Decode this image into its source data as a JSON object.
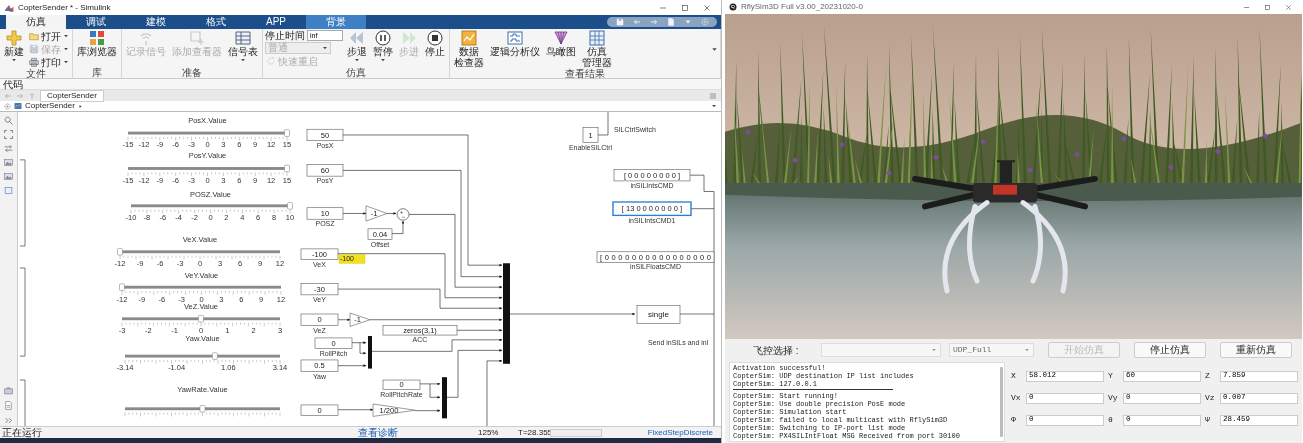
{
  "simulink": {
    "title": "CopterSender * - Simulink",
    "tabs": [
      {
        "label": "仿真",
        "selected": true,
        "contextual": false
      },
      {
        "label": "调试",
        "selected": false,
        "contextual": false
      },
      {
        "label": "建模",
        "selected": false,
        "contextual": false
      },
      {
        "label": "格式",
        "selected": false,
        "contextual": false
      },
      {
        "label": "APP",
        "selected": false,
        "contextual": false
      },
      {
        "label": "背景",
        "selected": false,
        "contextual": true
      }
    ],
    "ribbon_groups": [
      {
        "label": "文件",
        "items": [
          {
            "kind": "large",
            "label": "新建",
            "disabled": false,
            "menu": true
          },
          {
            "kind": "small",
            "label": "打开",
            "disabled": false,
            "menu": true
          },
          {
            "kind": "small",
            "label": "保存",
            "disabled": true,
            "menu": true
          },
          {
            "kind": "small",
            "label": "打印",
            "disabled": false,
            "menu": true
          }
        ]
      },
      {
        "label": "库",
        "items": [
          {
            "kind": "large",
            "label": "库浏览器",
            "disabled": false,
            "menu": false
          }
        ]
      },
      {
        "label": "准备",
        "items": [
          {
            "kind": "large",
            "label": "记录信号",
            "disabled": true,
            "menu": false
          },
          {
            "kind": "large",
            "label": "添加查看器",
            "disabled": true,
            "menu": false
          },
          {
            "kind": "large",
            "label": "信号表",
            "disabled": false,
            "menu": true
          }
        ]
      },
      {
        "label": "仿真",
        "items": [
          {
            "kind": "field",
            "label": "停止时间",
            "value": "inf",
            "disabled": false
          },
          {
            "kind": "dropdown",
            "label": "普通",
            "disabled": true,
            "menu": true
          },
          {
            "kind": "small",
            "label": "快速重启",
            "disabled": true,
            "menu": false
          },
          {
            "kind": "large",
            "label": "步退",
            "disabled": false,
            "menu": true
          },
          {
            "kind": "large",
            "label": "暂停",
            "disabled": false,
            "menu": true
          },
          {
            "kind": "large",
            "label": "步进",
            "disabled": true,
            "menu": false
          },
          {
            "kind": "large",
            "label": "停止",
            "disabled": false,
            "menu": false
          }
        ]
      },
      {
        "label": "查看结果",
        "items": [
          {
            "kind": "large",
            "label_lines": [
              "数据",
              "检查器"
            ],
            "disabled": false,
            "menu": false
          },
          {
            "kind": "large",
            "label": "逻辑分析仪",
            "disabled": false,
            "menu": false
          },
          {
            "kind": "large",
            "label": "鸟瞰图",
            "disabled": false,
            "menu": false
          },
          {
            "kind": "large",
            "label_lines": [
              "仿真",
              "管理器"
            ],
            "disabled": false,
            "menu": false
          }
        ]
      }
    ],
    "code_bar": "代码",
    "model_tab": "CopterSender",
    "breadcrumb": "CopterSender",
    "diagram": {
      "sliders": [
        {
          "label": "PosX.Value",
          "level": 1,
          "ticks": [
            "-15",
            "-12",
            "-9",
            "-6",
            "-3",
            "0",
            "3",
            "6",
            "9",
            "12",
            "15"
          ]
        },
        {
          "label": "PosY.Value",
          "level": 1,
          "ticks": [
            "-15",
            "-12",
            "-9",
            "-6",
            "-3",
            "0",
            "3",
            "6",
            "9",
            "12",
            "15"
          ]
        },
        {
          "label": "POSZ.Value",
          "level": 1,
          "ticks": [
            "-10",
            "-8",
            "-6",
            "-4",
            "-2",
            "0",
            "2",
            "4",
            "6",
            "8",
            "10"
          ]
        },
        {
          "label": "VeX.Value",
          "level": 0,
          "ticks": [
            "-12",
            "-9",
            "-6",
            "-3",
            "0",
            "3",
            "6",
            "9",
            "12"
          ]
        },
        {
          "label": "VeY.Value",
          "level": 0,
          "ticks": [
            "-12",
            "-9",
            "-6",
            "-3",
            "0",
            "3",
            "6",
            "9",
            "12"
          ]
        },
        {
          "label": "VeZ.Value",
          "level": 0.5,
          "ticks": [
            "-3",
            "-2",
            "-1",
            "0",
            "1",
            "2",
            "3"
          ]
        },
        {
          "label": "Yaw.Value",
          "level": 0.58,
          "ticks": [
            "-3.14",
            "-1.04",
            "1.06",
            "3.14"
          ]
        },
        {
          "label": "YawRate.Value",
          "level": 0.5
        }
      ],
      "blocks": [
        {
          "kind": "constant",
          "value": "50",
          "label": "PosX",
          "selected": false
        },
        {
          "kind": "constant",
          "value": "1",
          "label": "EnableSILCtrl",
          "selected": false
        },
        {
          "kind": "constant",
          "value": "60",
          "label": "PosY",
          "selected": false
        },
        {
          "kind": "constant",
          "value": "[ 0 0 0 0 0 0 0 0 ]",
          "label": "inSILIntsCMD",
          "selected": false
        },
        {
          "kind": "constant",
          "value": "10",
          "label": "POSZ",
          "selected": false
        },
        {
          "kind": "gain",
          "value": "-1",
          "selected": false
        },
        {
          "kind": "constant",
          "value": "[ 13 0 0 0 0 0 0 0 ]",
          "label": "inSILIntsCMD1",
          "selected": true
        },
        {
          "kind": "constant",
          "value": "0.04",
          "label": "Offset",
          "selected": false
        },
        {
          "kind": "constant",
          "value": "-100",
          "label": "VeX",
          "selected": false
        },
        {
          "kind": "display",
          "value": "-100",
          "selected": false
        },
        {
          "kind": "constant",
          "value": "[ 0 0 0 0 0 0 0 0 0 0 0 0 0 0 0 0",
          "label": "inSILFloatsCMD",
          "selected": false
        },
        {
          "kind": "constant",
          "value": "-30",
          "label": "VeY",
          "selected": false
        },
        {
          "kind": "constant",
          "value": "0",
          "label": "VeZ",
          "selected": false
        },
        {
          "kind": "gain",
          "value": "-1",
          "selected": false
        },
        {
          "kind": "convert",
          "value": "single",
          "selected": false
        },
        {
          "kind": "constant",
          "value": "zeros(3,1)",
          "label": "ACC",
          "selected": false
        },
        {
          "kind": "constant",
          "value": "0",
          "label": "RollPitch",
          "selected": false
        },
        {
          "kind": "constant",
          "value": "0.5",
          "label": "Yaw",
          "selected": false
        },
        {
          "kind": "constant",
          "value": "0",
          "label": "RollPitchRate",
          "selected": false
        },
        {
          "kind": "constant",
          "value": "0",
          "selected": false
        },
        {
          "kind": "gain",
          "value": "1/200",
          "selected": false
        }
      ],
      "annotations": [
        "SILCtrlSwitch",
        "Send inSILs and inl"
      ]
    },
    "status_bar": {
      "state": "正在运行",
      "diagnostics": "查看诊断",
      "zoom": "125%",
      "time": "T=28.355",
      "progress": {
        "level": 0
      },
      "solver": "FixedStepDiscrete"
    }
  },
  "rflysim": {
    "title": "RflySim3D Full v3.00_20231020-0",
    "controller_label": "飞控选择 :",
    "selects": [
      {
        "disabled": true
      },
      {
        "value": "UDP_Full",
        "disabled": true
      }
    ],
    "buttons": [
      {
        "label": "开始仿真",
        "disabled": true
      },
      {
        "label": "停止仿真",
        "disabled": false
      },
      {
        "label": "重新仿真",
        "disabled": false
      }
    ],
    "log": [
      {
        "kind": "text",
        "text": "Activation successful!"
      },
      {
        "kind": "text",
        "text": "CopterSim: UDP destination IP list includes"
      },
      {
        "kind": "text",
        "text": "CopterSim: 127.0.0.1"
      },
      {
        "kind": "rule"
      },
      {
        "kind": "text",
        "text": "CopterSim: Start running!"
      },
      {
        "kind": "text",
        "text": "CopterSim: Use double precision PosE mode"
      },
      {
        "kind": "text",
        "text": "CopterSim: Simulation start"
      },
      {
        "kind": "text",
        "text": "CopterSim: failed to local multicast with RflySim3D"
      },
      {
        "kind": "text",
        "text": "CopterSim: Switching to IP-port list mode"
      },
      {
        "kind": "text",
        "text": "CopterSim: PX4SILIntFloat MSG Received from port 30100"
      }
    ],
    "state_fields": [
      {
        "label": "X",
        "value": "58.012"
      },
      {
        "label": "Y",
        "value": "60"
      },
      {
        "label": "Z",
        "value": "7.859"
      },
      {
        "label": "Vx",
        "value": "0"
      },
      {
        "label": "Vy",
        "value": "0"
      },
      {
        "label": "Vz",
        "value": "0.007"
      },
      {
        "label": "Φ",
        "value": "0"
      },
      {
        "label": "θ",
        "value": "0"
      },
      {
        "label": "Ψ",
        "value": "28.459"
      }
    ]
  }
}
